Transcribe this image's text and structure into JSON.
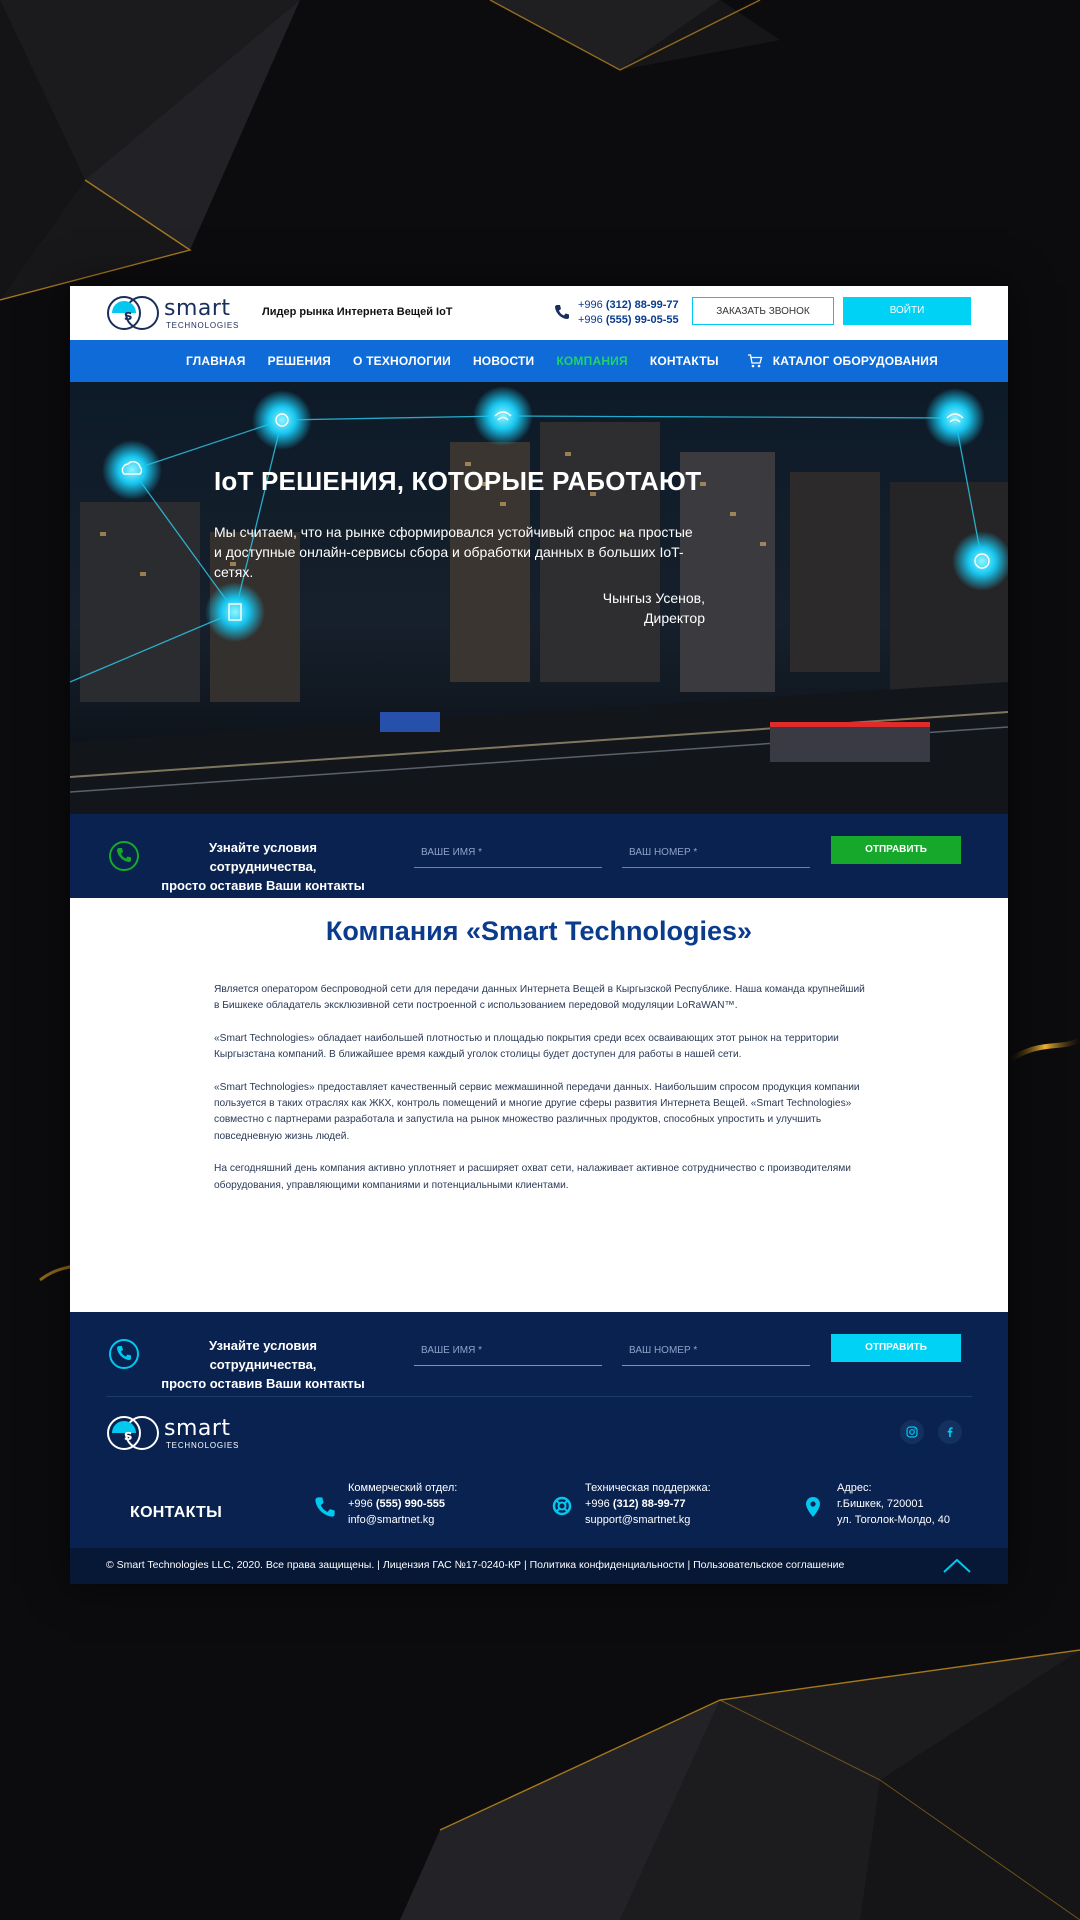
{
  "brand": {
    "name": "smart",
    "sub": "TECHNOLOGIES"
  },
  "header": {
    "tagline": "Лидер рынка Интернета Вещей IoT",
    "phones": [
      {
        "prefix": "+996 ",
        "number": "(312) 88-99-77"
      },
      {
        "prefix": "+996 ",
        "number": "(555) 99-05-55"
      }
    ],
    "call_button": "ЗАКАЗАТЬ ЗВОНОК",
    "login_button": "ВОЙТИ"
  },
  "nav": {
    "items": [
      "ГЛАВНАЯ",
      "РЕШЕНИЯ",
      "О ТЕХНОЛОГИИ",
      "НОВОСТИ",
      "КОМПАНИЯ",
      "КОНТАКТЫ"
    ],
    "active": "КОМПАНИЯ",
    "catalog": "КАТАЛОГ ОБОРУДОВАНИЯ"
  },
  "hero": {
    "title": "IoT РЕШЕНИЯ, КОТОРЫЕ РАБОТАЮТ",
    "text_line1": "Мы считаем, что на рынке сформировался устойчивый спрос на простые",
    "text_line2": "и доступные онлайн-сервисы сбора и обработки данных в больших IoT-сетях.",
    "author": "Чынгыз Усенов,",
    "author_role": "Директор"
  },
  "lead_form": {
    "text_line1": "Узнайте условия сотрудничества,",
    "text_line2": "просто оставив Ваши контакты",
    "name_placeholder": "ВАШЕ ИМЯ *",
    "phone_placeholder": "ВАШ НОМЕР *",
    "submit": "ОТПРАВИТЬ"
  },
  "company": {
    "title": "Компания «Smart Technologies»",
    "paragraphs": [
      "Является оператором беспроводной сети для передачи данных Интернета Вещей в Кыргызской Республике. Наша команда крупнейший в Бишкеке обладатель эксклюзивной сети построенной с использованием передовой модуляции LoRaWAN™.",
      "«Smart Technologies» обладает наибольшей плотностью и площадью покрытия среди всех осваивающих этот рынок на территории Кыргызстана компаний. В ближайшее время каждый уголок столицы будет доступен для работы в нашей сети.",
      "«Smart Technologies» предоставляет качественный сервис межмашинной передачи данных. Наибольшим спросом продукция компании пользуется в таких отраслях как ЖКХ, контроль помещений и многие другие сферы развития Интернета Вещей. «Smart Technologies» совместно с партнерами разработала и запустила на рынок множество различных продуктов, способных упростить и улучшить повседневную жизнь людей.",
      "На сегодняшний день компания активно уплотняет и расширяет охват сети, налаживает активное сотрудничество с производителями оборудования, управляющими компаниями и потенциальными клиентами."
    ]
  },
  "footer": {
    "contacts_title": "КОНТАКТЫ",
    "sales": {
      "label": "Коммерческий отдел:",
      "prefix": "+996 ",
      "number": "(555) 990-555",
      "email": "info@smartnet.kg"
    },
    "support": {
      "label": "Техническая поддержка:",
      "prefix": "+996 ",
      "number": "(312) 88-99-77",
      "email": "support@smartnet.kg"
    },
    "address": {
      "label": "Адрес:",
      "city": "г.Бишкек, 720001",
      "street": "ул. Тоголок-Молдо, 40"
    },
    "copyright": "© Smart Technologies LLC, 2020. Все права защищены. | Лицензия ГАС №17-0240-КР | Политика конфиденциальности | Пользовательское соглашение",
    "social": [
      "instagram-icon",
      "facebook-icon"
    ]
  },
  "colors": {
    "nav_blue": "#0f6bd8",
    "dark_navy": "#0a2250",
    "cyan": "#00d2f5",
    "green": "#16a82a",
    "active_nav": "#1fd36a"
  }
}
